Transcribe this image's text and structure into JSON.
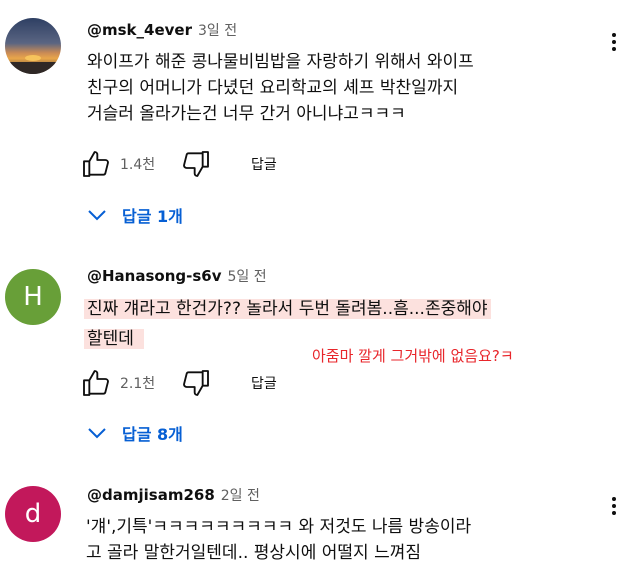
{
  "comments": [
    {
      "author": "@msk_4ever",
      "time": "3일 전",
      "avatar_type": "photo-sunset",
      "lines": [
        "와이프가 해준 콩나물비빔밥을 자랑하기 위해서 와이프",
        "친구의 어머니가 다녔던 요리학교의 셰프 박찬일까지",
        "거슬러 올라가는건 너무 간거 아니냐고ㅋㅋㅋ"
      ],
      "likes": "1.4천",
      "reply_label": "답글",
      "replies_label": "답글 1개"
    },
    {
      "author": "@Hanasong-s6v",
      "time": "5일 전",
      "avatar_letter": "H",
      "avatar_color": "#689f38",
      "lines": [
        "진짜 걔라고 한건가?? 놀라서 두번 돌려봄..흠...존중해야",
        "할텐데"
      ],
      "likes": "2.1천",
      "reply_label": "답글",
      "replies_label": "답글 8개"
    },
    {
      "author": "@damjisam268",
      "time": "2일 전",
      "avatar_letter": "d",
      "avatar_color": "#c2185b",
      "lines": [
        "'걔',기특'ㅋㅋㅋㅋㅋㅋㅋㅋㅋ 와 저것도 나름 방송이라",
        "고 골라 말한거일텐데.. 평상시에 어떨지 느껴짐"
      ]
    }
  ],
  "annotation": "아줌마 깔게 그거밖에  없음요?ㅋ",
  "colors": {
    "link_blue": "#065fd4",
    "highlight": "#f8c8c3",
    "annotation_red": "#e8262b"
  }
}
